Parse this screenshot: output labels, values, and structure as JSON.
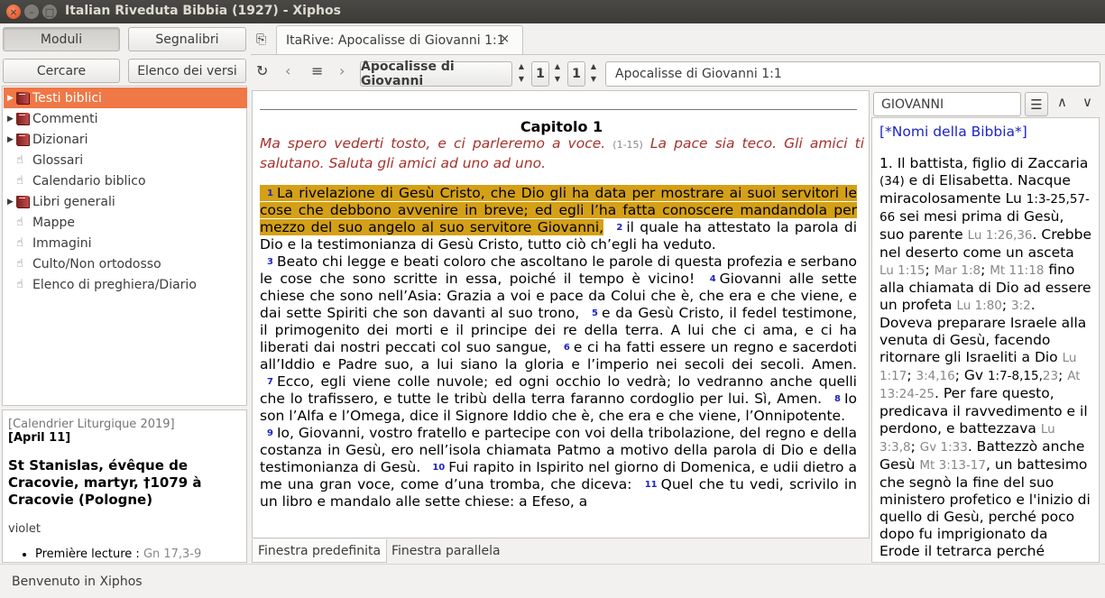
{
  "window": {
    "title": "Italian Riveduta Bibbia (1927) - Xiphos"
  },
  "sidebar": {
    "buttons": {
      "moduli": "Moduli",
      "segnalibri": "Segnalibri",
      "cercare": "Cercare",
      "elenco_versi": "Elenco dei versi"
    },
    "tree": [
      "Testi biblici",
      "Commenti",
      "Dizionari",
      "Glossari",
      "Calendario biblico",
      "Libri generali",
      "Mappe",
      "Immagini",
      "Culto/Non ortodosso",
      "Elenco di preghiera/Diario"
    ]
  },
  "calendar": {
    "source": "[Calendrier Liturgique 2019]",
    "date": "April 11",
    "title": "St Stanislas, évêque de Cracovie, martyr, †1079 à Cracovie (Pologne)",
    "color": "violet",
    "reading_label": "Première lecture :",
    "reading_ref": "Gn 17,3-9"
  },
  "tab": {
    "label": "ItaRive: Apocalisse di Giovanni 1:1",
    "close": "×"
  },
  "toolbar": {
    "book": "Apocalisse di Giovanni",
    "chapter": "1",
    "verse": "1",
    "reference": "Apocalisse di Giovanni 1:1"
  },
  "text": {
    "chapter_heading": "Capitolo  1",
    "summary_1": "Ma spero vederti tosto, e ci parleremo a voce.",
    "summary_ref": "(1-15)",
    "summary_2": "La pace sia teco. Gli amici ti salutano. Saluta gli amici ad uno ad uno.",
    "verses": [
      {
        "n": "1",
        "t": "La rivelazione di Gesù Cristo, che Dio gli ha data per mostrare ai suoi servitori le cose che debbono avvenire in breve; ed egli l’ha fatta conoscere mandandola per mezzo del suo angelo al suo servitore Giovanni,"
      },
      {
        "n": "2",
        "t": "il quale ha attestato la parola di Dio e la testimonianza di Gesù Cristo, tutto ciò ch’egli ha veduto."
      },
      {
        "n": "3",
        "t": "Beato chi legge e beati coloro che ascoltano le parole di questa profezia e serbano le cose che sono scritte in essa, poiché il tempo è vicino!"
      },
      {
        "n": "4",
        "t": "Giovanni alle sette chiese che sono nell’Asia: Grazia a voi e pace da Colui che è, che era e che viene, e dai sette Spiriti che son davanti al suo trono,"
      },
      {
        "n": "5",
        "t": "e da Gesù Cristo, il fedel testimone, il primogenito dei morti e il principe dei re della terra. A lui che ci ama, e ci ha liberati dai nostri peccati col suo sangue,"
      },
      {
        "n": "6",
        "t": "e ci ha fatti essere un regno e sacerdoti all’Iddio e Padre suo, a lui siano la gloria e l’imperio nei secoli dei secoli. Amen."
      },
      {
        "n": "7",
        "t": "Ecco, egli viene colle nuvole; ed ogni occhio lo vedrà; lo vedranno anche quelli che lo trafissero, e tutte le tribù della terra faranno cordoglio per lui. Sì, Amen."
      },
      {
        "n": "8",
        "t": "Io son l’Alfa e l’Omega, dice il Signore Iddio che è, che era e che viene, l’Onnipotente."
      },
      {
        "n": "9",
        "t": "Io, Giovanni, vostro fratello e partecipe con voi della tribolazione, del regno e della costanza in Gesù, ero nell’isola chiamata Patmo a motivo della parola di Dio e della testimonianza di Gesù."
      },
      {
        "n": "10",
        "t": "Fui rapito in Ispirito nel giorno di Domenica, e udii dietro a me una gran voce, come d’una tromba, che diceva:"
      },
      {
        "n": "11",
        "t": "Quel che tu vedi, scrivilo in un libro e mandalo alle sette chiese: a Efeso, a"
      }
    ]
  },
  "bottom_tabs": {
    "default": "Finestra predefinita",
    "parallel": "Finestra parallela"
  },
  "dictionary": {
    "search": "GIOVANNI",
    "module": "[*Nomi della Bibbia*]",
    "entry": [
      {
        "k": "t",
        "v": "1. Il battista, figlio di Zaccaria "
      },
      {
        "k": "rd",
        "v": "(34)"
      },
      {
        "k": "t",
        "v": " e di Elisabetta. Nacque miracolosamente "
      },
      {
        "k": "t",
        "v": "Lu "
      },
      {
        "k": "rd",
        "v": "1:3-25,57-66"
      },
      {
        "k": "t",
        "v": " sei mesi prima di Gesù, suo parente "
      },
      {
        "k": "r",
        "v": "Lu 1:26,36"
      },
      {
        "k": "t",
        "v": ". Crebbe nel deserto come un asceta "
      },
      {
        "k": "r",
        "v": "Lu 1:15"
      },
      {
        "k": "t",
        "v": "; "
      },
      {
        "k": "r",
        "v": "Mar 1:8"
      },
      {
        "k": "t",
        "v": "; "
      },
      {
        "k": "r",
        "v": "Mt 11:18"
      },
      {
        "k": "t",
        "v": " fino alla chiamata di Dio ad essere un profeta "
      },
      {
        "k": "r",
        "v": "Lu 1:80"
      },
      {
        "k": "t",
        "v": "; "
      },
      {
        "k": "r",
        "v": "3:2"
      },
      {
        "k": "t",
        "v": ". Doveva preparare Israele alla venuta di Gesù, facendo ritornare gli Israeliti a Dio "
      },
      {
        "k": "r",
        "v": "Lu 1:17"
      },
      {
        "k": "t",
        "v": "; "
      },
      {
        "k": "r",
        "v": "3:4,16"
      },
      {
        "k": "t",
        "v": "; Gv "
      },
      {
        "k": "rd",
        "v": "1:7-8,15,"
      },
      {
        "k": "r",
        "v": "23"
      },
      {
        "k": "t",
        "v": "; "
      },
      {
        "k": "r",
        "v": "At 13:24-25"
      },
      {
        "k": "t",
        "v": ". Per fare questo, predicava il ravvedimento e il perdono, e battezzava "
      },
      {
        "k": "r",
        "v": "Lu 3:3,8"
      },
      {
        "k": "t",
        "v": "; "
      },
      {
        "k": "r",
        "v": "Gv 1:33"
      },
      {
        "k": "t",
        "v": ". Battezzò anche Gesù "
      },
      {
        "k": "r",
        "v": "Mt 3:13-17"
      },
      {
        "k": "t",
        "v": ", un battesimo che segnò la fine del suo ministero profetico e l'inizio di quello di Gesù, perché poco dopo fu imprigionato da Erode il tetrarca perché"
      }
    ]
  },
  "status": "Benvenuto in Xiphos",
  "colors": {
    "selection": "#f07746",
    "highlight": "#d4a017",
    "summary": "#a5322c",
    "verse_number": "#1c24c4"
  }
}
